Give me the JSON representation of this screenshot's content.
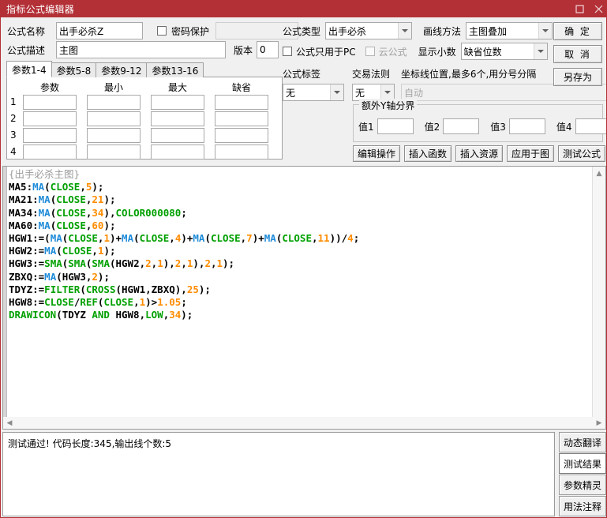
{
  "titlebar": {
    "title": "指标公式编辑器",
    "maximize_icon": "maximize-icon",
    "close_icon": "close-icon"
  },
  "form": {
    "name_label": "公式名称",
    "name_value": "出手必杀Z",
    "password_protect_label": "密码保护",
    "password_value": "",
    "desc_label": "公式描述",
    "desc_value": "主图",
    "version_label": "版本",
    "version_value": "0",
    "type_label": "公式类型",
    "type_value": "出手必杀",
    "draw_method_label": "画线方法",
    "draw_method_value": "主图叠加",
    "pc_only_label": "公式只用于PC",
    "cloud_formula_label": "云公式",
    "decimals_label": "显示小数",
    "decimals_value": "缺省位数",
    "formula_tag_label": "公式标签",
    "formula_tag_value": "无",
    "trade_rule_label": "交易法则",
    "trade_rule_value": "无",
    "coord_label": "坐标线位置,最多6个,用分号分隔",
    "coord_placeholder": "自动"
  },
  "params": {
    "tabs": [
      {
        "label": "参数1-4",
        "active": true
      },
      {
        "label": "参数5-8",
        "active": false
      },
      {
        "label": "参数9-12",
        "active": false
      },
      {
        "label": "参数13-16",
        "active": false
      }
    ],
    "columns": [
      "参数",
      "最小",
      "最大",
      "缺省"
    ],
    "rows": [
      {
        "index": "1",
        "values": [
          "",
          "",
          "",
          ""
        ]
      },
      {
        "index": "2",
        "values": [
          "",
          "",
          "",
          ""
        ]
      },
      {
        "index": "3",
        "values": [
          "",
          "",
          "",
          ""
        ]
      },
      {
        "index": "4",
        "values": [
          "",
          "",
          "",
          ""
        ]
      }
    ]
  },
  "extra_y": {
    "group_title": "额外Y轴分界",
    "fields": [
      {
        "label": "值1",
        "value": ""
      },
      {
        "label": "值2",
        "value": ""
      },
      {
        "label": "值3",
        "value": ""
      },
      {
        "label": "值4",
        "value": ""
      }
    ]
  },
  "actions": [
    {
      "label": "编辑操作"
    },
    {
      "label": "插入函数"
    },
    {
      "label": "插入资源"
    },
    {
      "label": "应用于图"
    },
    {
      "label": "测试公式"
    }
  ],
  "dialog_buttons": [
    {
      "label": "确 定"
    },
    {
      "label": "取 消"
    },
    {
      "label": "另存为"
    }
  ],
  "editor": {
    "code_lines": [
      [
        {
          "t": "{出手必杀主图}",
          "c": "comment"
        }
      ],
      [
        {
          "t": "MA5",
          "c": "var"
        },
        {
          "t": ":",
          "c": "op"
        },
        {
          "t": "MA",
          "c": "fn"
        },
        {
          "t": "(",
          "c": "op"
        },
        {
          "t": "CLOSE",
          "c": "kw"
        },
        {
          "t": ",",
          "c": "op"
        },
        {
          "t": "5",
          "c": "num"
        },
        {
          "t": ");",
          "c": "op"
        }
      ],
      [
        {
          "t": "MA21",
          "c": "var"
        },
        {
          "t": ":",
          "c": "op"
        },
        {
          "t": "MA",
          "c": "fn"
        },
        {
          "t": "(",
          "c": "op"
        },
        {
          "t": "CLOSE",
          "c": "kw"
        },
        {
          "t": ",",
          "c": "op"
        },
        {
          "t": "21",
          "c": "num"
        },
        {
          "t": ");",
          "c": "op"
        }
      ],
      [
        {
          "t": "MA34",
          "c": "var"
        },
        {
          "t": ":",
          "c": "op"
        },
        {
          "t": "MA",
          "c": "fn"
        },
        {
          "t": "(",
          "c": "op"
        },
        {
          "t": "CLOSE",
          "c": "kw"
        },
        {
          "t": ",",
          "c": "op"
        },
        {
          "t": "34",
          "c": "num"
        },
        {
          "t": "),",
          "c": "op"
        },
        {
          "t": "COLOR000080",
          "c": "kw"
        },
        {
          "t": ";",
          "c": "op"
        }
      ],
      [
        {
          "t": "MA60",
          "c": "var"
        },
        {
          "t": ":",
          "c": "op"
        },
        {
          "t": "MA",
          "c": "fn"
        },
        {
          "t": "(",
          "c": "op"
        },
        {
          "t": "CLOSE",
          "c": "kw"
        },
        {
          "t": ",",
          "c": "op"
        },
        {
          "t": "60",
          "c": "num"
        },
        {
          "t": ");",
          "c": "op"
        }
      ],
      [
        {
          "t": "HGW1",
          "c": "var"
        },
        {
          "t": ":=(",
          "c": "op"
        },
        {
          "t": "MA",
          "c": "fn"
        },
        {
          "t": "(",
          "c": "op"
        },
        {
          "t": "CLOSE",
          "c": "kw"
        },
        {
          "t": ",",
          "c": "op"
        },
        {
          "t": "1",
          "c": "num"
        },
        {
          "t": ")+",
          "c": "op"
        },
        {
          "t": "MA",
          "c": "fn"
        },
        {
          "t": "(",
          "c": "op"
        },
        {
          "t": "CLOSE",
          "c": "kw"
        },
        {
          "t": ",",
          "c": "op"
        },
        {
          "t": "4",
          "c": "num"
        },
        {
          "t": ")+",
          "c": "op"
        },
        {
          "t": "MA",
          "c": "fn"
        },
        {
          "t": "(",
          "c": "op"
        },
        {
          "t": "CLOSE",
          "c": "kw"
        },
        {
          "t": ",",
          "c": "op"
        },
        {
          "t": "7",
          "c": "num"
        },
        {
          "t": ")+",
          "c": "op"
        },
        {
          "t": "MA",
          "c": "fn"
        },
        {
          "t": "(",
          "c": "op"
        },
        {
          "t": "CLOSE",
          "c": "kw"
        },
        {
          "t": ",",
          "c": "op"
        },
        {
          "t": "11",
          "c": "num"
        },
        {
          "t": "))/",
          "c": "op"
        },
        {
          "t": "4",
          "c": "num"
        },
        {
          "t": ";",
          "c": "op"
        }
      ],
      [
        {
          "t": "HGW2",
          "c": "var"
        },
        {
          "t": ":=",
          "c": "op"
        },
        {
          "t": "MA",
          "c": "fn"
        },
        {
          "t": "(",
          "c": "op"
        },
        {
          "t": "CLOSE",
          "c": "kw"
        },
        {
          "t": ",",
          "c": "op"
        },
        {
          "t": "1",
          "c": "num"
        },
        {
          "t": ");",
          "c": "op"
        }
      ],
      [
        {
          "t": "HGW3",
          "c": "var"
        },
        {
          "t": ":=",
          "c": "op"
        },
        {
          "t": "SMA",
          "c": "kw"
        },
        {
          "t": "(",
          "c": "op"
        },
        {
          "t": "SMA",
          "c": "kw"
        },
        {
          "t": "(",
          "c": "op"
        },
        {
          "t": "SMA",
          "c": "kw"
        },
        {
          "t": "(HGW2,",
          "c": "op"
        },
        {
          "t": "2",
          "c": "num"
        },
        {
          "t": ",",
          "c": "op"
        },
        {
          "t": "1",
          "c": "num"
        },
        {
          "t": "),",
          "c": "op"
        },
        {
          "t": "2",
          "c": "num"
        },
        {
          "t": ",",
          "c": "op"
        },
        {
          "t": "1",
          "c": "num"
        },
        {
          "t": "),",
          "c": "op"
        },
        {
          "t": "2",
          "c": "num"
        },
        {
          "t": ",",
          "c": "op"
        },
        {
          "t": "1",
          "c": "num"
        },
        {
          "t": ");",
          "c": "op"
        }
      ],
      [
        {
          "t": "ZBXQ",
          "c": "var"
        },
        {
          "t": ":=",
          "c": "op"
        },
        {
          "t": "MA",
          "c": "fn"
        },
        {
          "t": "(HGW3,",
          "c": "op"
        },
        {
          "t": "2",
          "c": "num"
        },
        {
          "t": ");",
          "c": "op"
        }
      ],
      [
        {
          "t": "TDYZ",
          "c": "var"
        },
        {
          "t": ":=",
          "c": "op"
        },
        {
          "t": "FILTER",
          "c": "kw"
        },
        {
          "t": "(",
          "c": "op"
        },
        {
          "t": "CROSS",
          "c": "kw"
        },
        {
          "t": "(HGW1,ZBXQ),",
          "c": "op"
        },
        {
          "t": "25",
          "c": "num"
        },
        {
          "t": ");",
          "c": "op"
        }
      ],
      [
        {
          "t": "HGW8",
          "c": "var"
        },
        {
          "t": ":=",
          "c": "op"
        },
        {
          "t": "CLOSE",
          "c": "kw"
        },
        {
          "t": "/",
          "c": "op"
        },
        {
          "t": "REF",
          "c": "kw"
        },
        {
          "t": "(",
          "c": "op"
        },
        {
          "t": "CLOSE",
          "c": "kw"
        },
        {
          "t": ",",
          "c": "op"
        },
        {
          "t": "1",
          "c": "num"
        },
        {
          "t": ")>",
          "c": "op"
        },
        {
          "t": "1.05",
          "c": "num"
        },
        {
          "t": ";",
          "c": "op"
        }
      ],
      [
        {
          "t": "DRAWICON",
          "c": "kw"
        },
        {
          "t": "(TDYZ ",
          "c": "op"
        },
        {
          "t": "AND",
          "c": "kw"
        },
        {
          "t": " HGW8,",
          "c": "op"
        },
        {
          "t": "LOW",
          "c": "kw"
        },
        {
          "t": ",",
          "c": "op"
        },
        {
          "t": "34",
          "c": "num"
        },
        {
          "t": ");",
          "c": "op"
        }
      ]
    ]
  },
  "output": {
    "status_text": "测试通过! 代码长度:345,输出线个数:5"
  },
  "right_tabs": [
    {
      "label": "动态翻译",
      "active": false
    },
    {
      "label": "测试结果",
      "active": true
    },
    {
      "label": "参数精灵",
      "active": false
    },
    {
      "label": "用法注释",
      "active": false
    }
  ],
  "colors": {
    "title_bar": "#b33037",
    "accent_fn": "#1e8bd8",
    "accent_kw": "#00a000",
    "accent_num": "#ff8c00",
    "comment": "#9a9a9a"
  }
}
